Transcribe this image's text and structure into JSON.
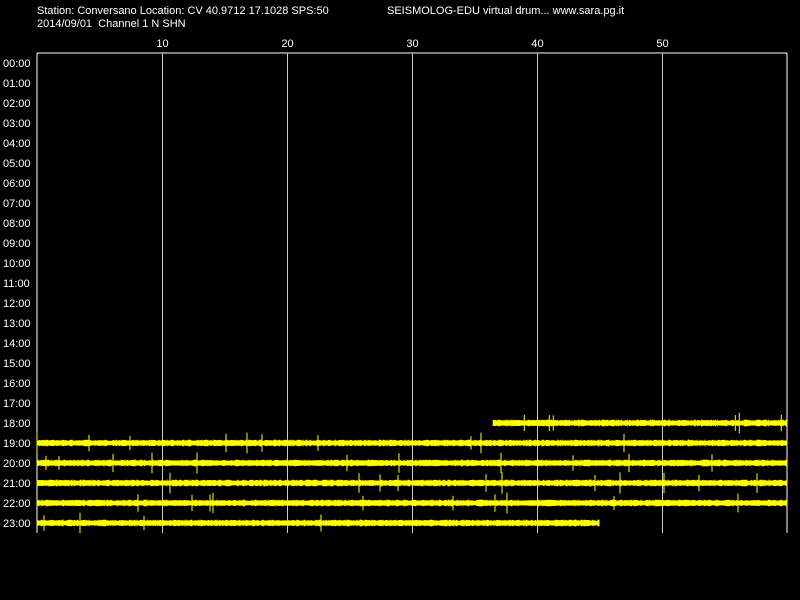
{
  "header": {
    "station_line": "Station: Conversano Location: CV 40.9712 17.1028 SPS:50",
    "date_channel_line": "2014/09/01  Channel 1 N SHN",
    "app_line": "SEISMOLOG-EDU virtual drum... www.sara.pg.it"
  },
  "colors": {
    "background": "#000000",
    "trace": "#ffff00",
    "grid": "#ffffff",
    "text": "#ffffff"
  },
  "chart_data": {
    "type": "line",
    "title": "",
    "xlabel": "",
    "ylabel": "",
    "x_ticks": [
      "10",
      "20",
      "30",
      "40",
      "50"
    ],
    "x_tick_values": [
      10,
      20,
      30,
      40,
      50
    ],
    "xlim": [
      0,
      60
    ],
    "x_unit": "minutes",
    "y_ticks": [
      "00:00",
      "01:00",
      "02:00",
      "03:00",
      "04:00",
      "05:00",
      "06:00",
      "07:00",
      "08:00",
      "09:00",
      "10:00",
      "11:00",
      "12:00",
      "13:00",
      "14:00",
      "15:00",
      "16:00",
      "17:00",
      "18:00",
      "19:00",
      "20:00",
      "21:00",
      "22:00",
      "23:00"
    ],
    "grid": "vertical",
    "series": [
      {
        "hour": "18:00",
        "start_min": 36.5,
        "end_min": 60
      },
      {
        "hour": "19:00",
        "start_min": 0,
        "end_min": 60
      },
      {
        "hour": "20:00",
        "start_min": 0,
        "end_min": 60
      },
      {
        "hour": "21:00",
        "start_min": 0,
        "end_min": 60
      },
      {
        "hour": "22:00",
        "start_min": 0,
        "end_min": 60
      },
      {
        "hour": "23:00",
        "start_min": 0,
        "end_min": 45
      }
    ]
  }
}
